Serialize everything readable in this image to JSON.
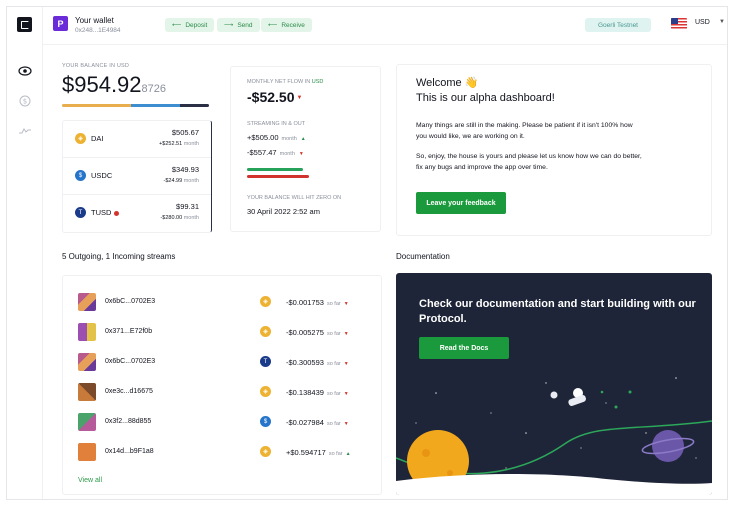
{
  "topbar": {
    "wallet_avatar_letter": "P",
    "wallet_title": "Your wallet",
    "wallet_address": "0x248...1E4984",
    "deposit_label": "Deposit",
    "send_label": "Send",
    "receive_label": "Receive",
    "network_label": "Goerli Testnet",
    "currency_label": "USD"
  },
  "balance": {
    "label": "YOUR BALANCE IN USD",
    "value_main": "$954.92",
    "value_fraction": "8726",
    "bar_colors": [
      "#e8ad4c",
      "#3d8ed1",
      "#2a2f45"
    ],
    "tokens": [
      {
        "name": "DAI",
        "value": "$505.67",
        "flow": "+$252.51",
        "flow_unit": "month",
        "color": "#eeb233",
        "icon": "dai-icon"
      },
      {
        "name": "USDC",
        "value": "$349.93",
        "flow": "-$24.99",
        "flow_unit": "month",
        "color": "#2775ca",
        "icon": "usdc-icon"
      },
      {
        "name": "TUSD",
        "value": "$99.31",
        "flow": "-$280.00",
        "flow_unit": "month",
        "color": "#1a5aff",
        "icon": "tusd-icon"
      }
    ]
  },
  "netflow": {
    "label_prefix": "MONTHLY NET FLOW IN ",
    "label_currency": "USD",
    "value": "-$52.50",
    "streaming_label": "STREAMING IN & OUT",
    "in_value": "+$505.00",
    "out_value": "-$557.47",
    "unit": "month",
    "zero_label": "YOUR BALANCE WILL HIT ZERO ON",
    "zero_date": "30 April 2022 2:52 am"
  },
  "welcome": {
    "title_line1": "Welcome 👋",
    "title_line2": "This is our alpha dashboard!",
    "paragraph1": "Many things are still in the making. Please be patient if it isn't 100% how you would like, we are working on it.",
    "paragraph2": "So, enjoy, the house is yours and please let us know how we can do better, fix any bugs and improve the app over time.",
    "feedback_button": "Leave your feedback"
  },
  "streams": {
    "title": "5 Outgoing, 1 Incoming streams",
    "view_all": "View all",
    "so_far": "so far",
    "rows": [
      {
        "address": "0x6bC...0702E3",
        "amount": "-$0.001753",
        "token": "dai",
        "direction": "out",
        "avatar_color": "#b95a8c"
      },
      {
        "address": "0x371...E72f0b",
        "amount": "-$0.005275",
        "token": "dai",
        "direction": "out",
        "avatar_color": "#9c4fb1"
      },
      {
        "address": "0x6bC...0702E3",
        "amount": "-$0.300593",
        "token": "tusd",
        "direction": "out",
        "avatar_color": "#b95a8c"
      },
      {
        "address": "0xe3c...d16675",
        "amount": "-$0.138439",
        "token": "dai",
        "direction": "out",
        "avatar_color": "#c77a3a"
      },
      {
        "address": "0x3f2...88d855",
        "amount": "-$0.027984",
        "token": "usdc",
        "direction": "out",
        "avatar_color": "#4aa36a"
      },
      {
        "address": "0x14d...b9F1a8",
        "amount": "+$0.594717",
        "token": "dai",
        "direction": "in",
        "avatar_color": "#e0803a"
      }
    ]
  },
  "docs": {
    "title": "Documentation",
    "headline": "Check our documentation and start building with our Protocol.",
    "button": "Read the Docs"
  }
}
